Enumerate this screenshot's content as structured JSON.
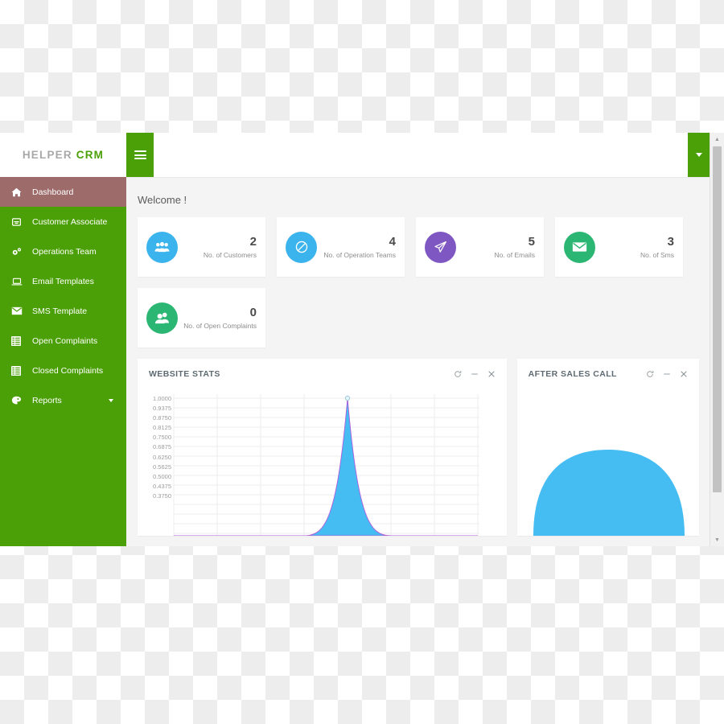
{
  "brand": {
    "name_primary": "HELPER",
    "name_accent": "CRM"
  },
  "colors": {
    "sidebar_green": "#4ca007",
    "active_item": "#9e6b6b",
    "blue": "#3bb3ec",
    "purple": "#7e57c2",
    "green": "#2cb673",
    "content_bg": "#f4f4f4"
  },
  "header": {
    "menu_toggle_icon": "hamburger-icon",
    "user_dropdown_icon": "caret-down-icon"
  },
  "sidebar": {
    "items": [
      {
        "label": "Dashboard",
        "icon": "home-icon",
        "active": true,
        "has_caret": false
      },
      {
        "label": "Customer Associate",
        "icon": "inbox-icon",
        "active": false,
        "has_caret": false
      },
      {
        "label": "Operations Team",
        "icon": "gears-icon",
        "active": false,
        "has_caret": false
      },
      {
        "label": "Email Templates",
        "icon": "laptop-icon",
        "active": false,
        "has_caret": false
      },
      {
        "label": "SMS Template",
        "icon": "envelope-icon",
        "active": false,
        "has_caret": false
      },
      {
        "label": "Open Complaints",
        "icon": "list-icon",
        "active": false,
        "has_caret": false
      },
      {
        "label": "Closed Complaints",
        "icon": "list-icon",
        "active": false,
        "has_caret": false
      },
      {
        "label": "Reports",
        "icon": "palette-icon",
        "active": false,
        "has_caret": true
      }
    ]
  },
  "main": {
    "welcome": "Welcome !",
    "stats": [
      {
        "value": "2",
        "label": "No. of Customers",
        "icon": "users-icon",
        "color": "#3bb3ec"
      },
      {
        "value": "4",
        "label": "No. of Operation Teams",
        "icon": "compass-icon",
        "color": "#3bb3ec"
      },
      {
        "value": "5",
        "label": "No. of Emails",
        "icon": "paper-plane-icon",
        "color": "#7e57c2"
      },
      {
        "value": "3",
        "label": "No. of Sms",
        "icon": "envelope-icon",
        "color": "#2cb673"
      },
      {
        "value": "0",
        "label": "No. of Open Complaints",
        "icon": "user-group-icon",
        "color": "#2cb673"
      }
    ],
    "panels": [
      {
        "title": "WEBSITE STATS",
        "tools": [
          "refresh-icon",
          "minimize-icon",
          "close-icon"
        ]
      },
      {
        "title": "AFTER SALES CALL",
        "tools": [
          "refresh-icon",
          "minimize-icon",
          "close-icon"
        ]
      }
    ]
  },
  "chart_data": [
    {
      "type": "area",
      "title": "WEBSITE STATS",
      "xlabel": "",
      "ylabel": "",
      "ylim": [
        0,
        1
      ],
      "grid": true,
      "legend": null,
      "ytick_labels": [
        "1.0000",
        "0.9375",
        "0.8750",
        "0.8125",
        "0.7500",
        "0.6875",
        "0.6250",
        "0.5625",
        "0.5000",
        "0.4375",
        "0.3750"
      ],
      "ytick_values": [
        1.0,
        0.9375,
        0.875,
        0.8125,
        0.75,
        0.6875,
        0.625,
        0.5625,
        0.5,
        0.4375,
        0.375
      ],
      "series": [
        {
          "name": "Website Stats",
          "color": "#3bb3ec",
          "x": [
            0,
            1,
            2,
            3,
            4,
            5,
            6,
            7
          ],
          "values": [
            0,
            0,
            0,
            1,
            0,
            0,
            0,
            0
          ]
        }
      ]
    },
    {
      "type": "area",
      "title": "AFTER SALES CALL",
      "xlabel": "",
      "ylabel": "",
      "ylim": [
        0,
        1
      ],
      "grid": false,
      "legend": null,
      "series": [
        {
          "name": "After Sales Call",
          "color": "#3bb3ec",
          "x": [
            0,
            1,
            2,
            3,
            4
          ],
          "values": [
            0,
            0.85,
            1,
            0.85,
            0
          ]
        }
      ]
    }
  ],
  "scrollbar": {
    "up_arrow": "▲",
    "down_arrow": "▼"
  }
}
